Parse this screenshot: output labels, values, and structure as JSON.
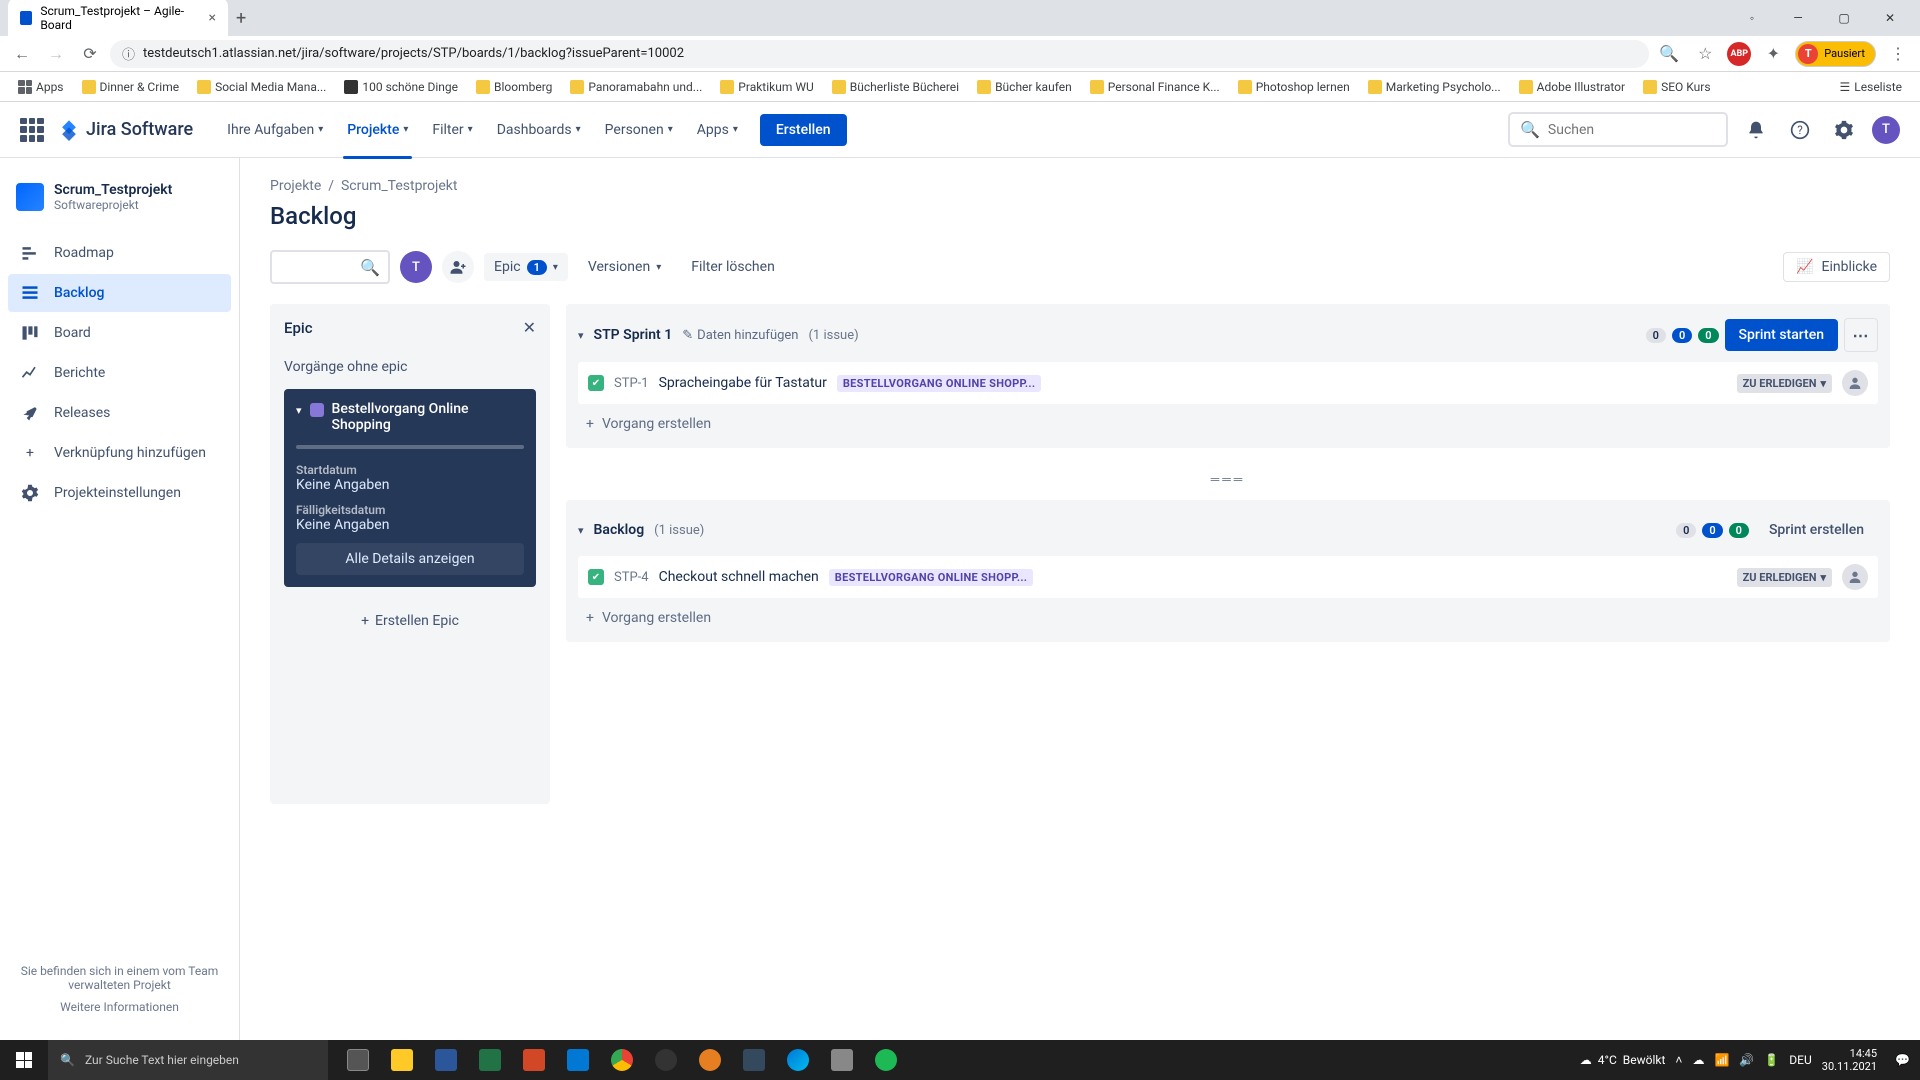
{
  "browser": {
    "tab_title": "Scrum_Testprojekt – Agile-Board",
    "url": "testdeutsch1.atlassian.net/jira/software/projects/STP/boards/1/backlog?issueParent=10002",
    "profile_state": "Pausiert",
    "bookmarks": {
      "apps": "Apps",
      "items": [
        "Dinner & Crime",
        "Social Media Mana...",
        "100 schöne Dinge",
        "Bloomberg",
        "Panoramabahn und...",
        "Praktikum WU",
        "Bücherliste Bücherei",
        "Bücher kaufen",
        "Personal Finance K...",
        "Photoshop lernen",
        "Marketing Psycholo...",
        "Adobe Illustrator",
        "SEO Kurs"
      ],
      "right": "Leseliste"
    }
  },
  "nav": {
    "product": "Jira Software",
    "items": [
      "Ihre Aufgaben",
      "Projekte",
      "Filter",
      "Dashboards",
      "Personen",
      "Apps"
    ],
    "active": "Projekte",
    "create": "Erstellen",
    "search_placeholder": "Suchen"
  },
  "sidebar": {
    "project_name": "Scrum_Testprojekt",
    "project_type": "Softwareprojekt",
    "items": [
      "Roadmap",
      "Backlog",
      "Board",
      "Berichte",
      "Releases",
      "Verknüpfung hinzufügen",
      "Projekteinstellungen"
    ],
    "active": "Backlog",
    "footer_text": "Sie befinden sich in einem vom Team verwalteten Projekt",
    "footer_link": "Weitere Informationen"
  },
  "breadcrumb": {
    "root": "Projekte",
    "project": "Scrum_Testprojekt"
  },
  "page": {
    "title": "Backlog"
  },
  "toolbar": {
    "user_initial": "T",
    "epic_label": "Epic",
    "epic_count": "1",
    "versions_label": "Versionen",
    "clear_filter": "Filter löschen",
    "insights": "Einblicke"
  },
  "epic_panel": {
    "title": "Epic",
    "no_epic": "Vorgänge ohne epic",
    "selected_name": "Bestellvorgang Online Shopping",
    "start_label": "Startdatum",
    "start_value": "Keine Angaben",
    "due_label": "Fälligkeitsdatum",
    "due_value": "Keine Angaben",
    "details_btn": "Alle Details anzeigen",
    "create_epic": "Erstellen Epic"
  },
  "sprint1": {
    "name": "STP Sprint 1",
    "add_dates": "Daten hinzufügen",
    "count_text": "(1 issue)",
    "counts": {
      "grey": "0",
      "blue": "0",
      "green": "0"
    },
    "start_btn": "Sprint starten",
    "issue_key": "STP-1",
    "issue_summary": "Spracheingabe für Tastatur",
    "issue_epic": "BESTELLVORGANG ONLINE SHOPP...",
    "issue_status": "ZU ERLEDIGEN",
    "create_issue": "Vorgang erstellen"
  },
  "backlog": {
    "name": "Backlog",
    "count_text": "(1 issue)",
    "counts": {
      "grey": "0",
      "blue": "0",
      "green": "0"
    },
    "create_sprint": "Sprint erstellen",
    "issue_key": "STP-4",
    "issue_summary": "Checkout schnell machen",
    "issue_epic": "BESTELLVORGANG ONLINE SHOPP...",
    "issue_status": "ZU ERLEDIGEN",
    "create_issue": "Vorgang erstellen"
  },
  "taskbar": {
    "search_placeholder": "Zur Suche Text hier eingeben",
    "weather_temp": "4°C",
    "weather_text": "Bewölkt",
    "lang": "DEU",
    "time": "14:45",
    "date": "30.11.2021"
  }
}
